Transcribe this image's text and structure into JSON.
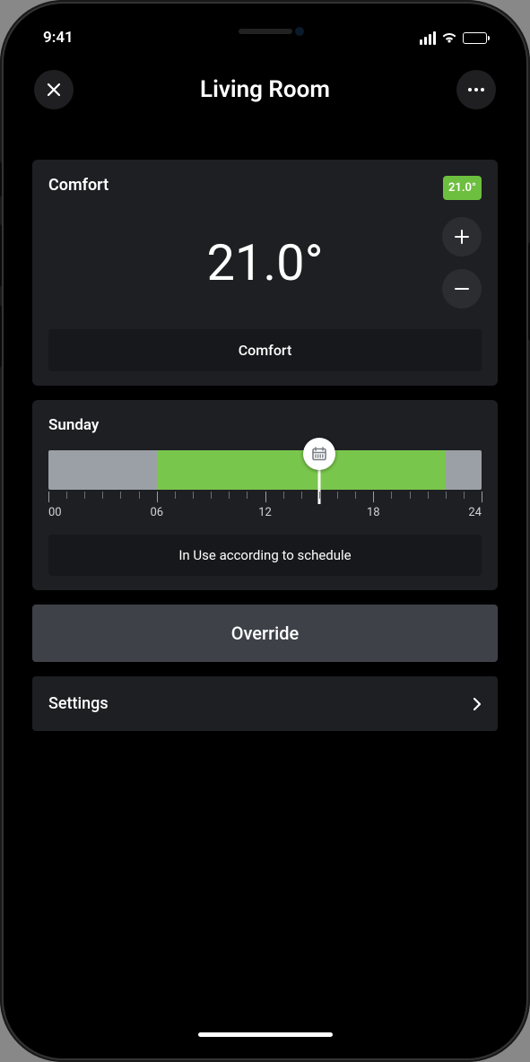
{
  "status": {
    "time": "9:41"
  },
  "header": {
    "title": "Living Room"
  },
  "temp_card": {
    "mode_label": "Comfort",
    "badge": "21.0°",
    "value": "21.0°",
    "selector_label": "Comfort"
  },
  "schedule": {
    "day": "Sunday",
    "segments": [
      {
        "active": false,
        "width_pct": 2.5
      },
      {
        "active": false,
        "width_pct": 22.5
      },
      {
        "active": true,
        "width_pct": 66.7
      },
      {
        "active": false,
        "width_pct": 6.3
      },
      {
        "active": false,
        "width_pct": 2.0
      }
    ],
    "marker_pct": 62,
    "ticks": [
      "00",
      "06",
      "12",
      "18",
      "24"
    ],
    "status_text": "In Use according to schedule"
  },
  "override": {
    "label": "Override"
  },
  "settings": {
    "label": "Settings"
  },
  "colors": {
    "accent_green": "#79c64c",
    "badge_green": "#6dbf3f",
    "inactive_grey": "#9aa0a6"
  }
}
